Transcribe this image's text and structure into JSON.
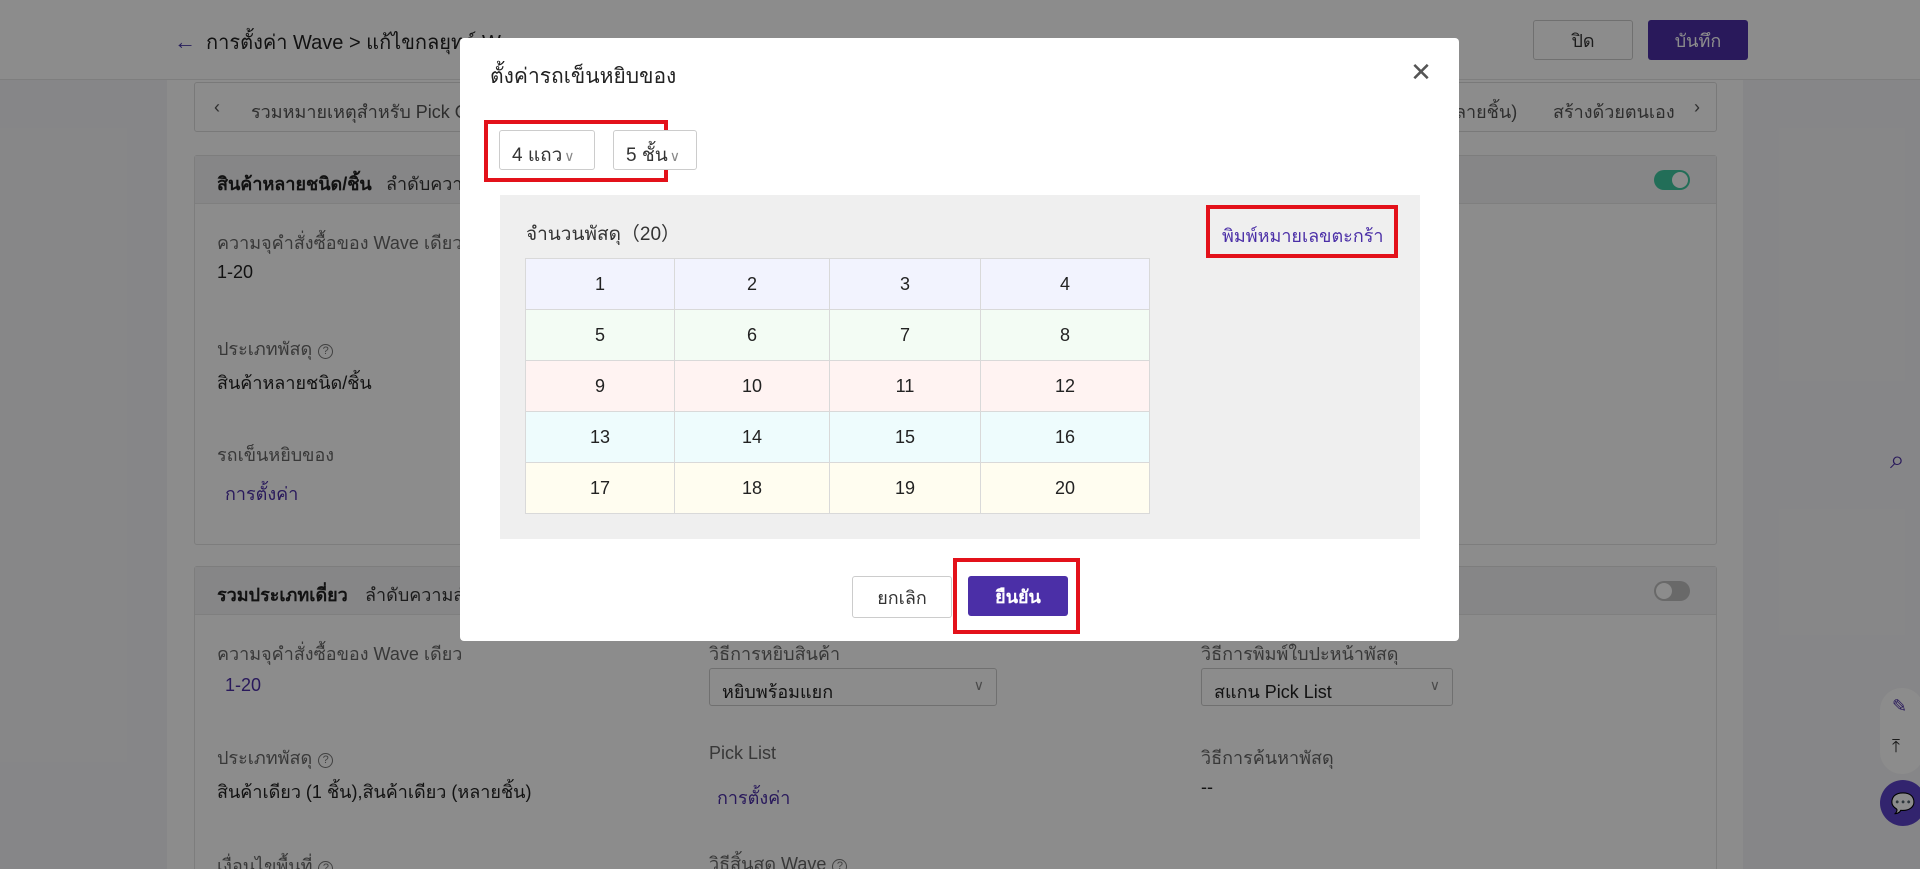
{
  "header": {
    "breadcrumb": "การตั้งค่า Wave > แก้ไขกลยุทธ์ Wave",
    "close_label": "ปิด",
    "save_label": "บันทึก"
  },
  "tabs": {
    "left_text": "รวมหมายเหตุสำหรับ Pick O",
    "right_text_1": "ลายชิ้น)",
    "right_text_2": "สร้างด้วยตนเอง"
  },
  "card1": {
    "title": "สินค้าหลายชนิด/ชิ้น",
    "subtitle": "ลำดับความ",
    "toggle_on": true,
    "capacity_label": "ความจุคำสั่งซื้อของ Wave เดียว",
    "capacity_value": "1-20",
    "parcel_type_label": "ประเภทพัสดุ",
    "parcel_type_value": "สินค้าหลายชนิด/ชิ้น",
    "cart_label": "รถเข็นหยิบของ",
    "cart_link": "การตั้งค่า"
  },
  "card2": {
    "title": "รวมประเภทเดี่ยว",
    "subtitle": "ลำดับความสำ",
    "toggle_on": false,
    "capacity_label": "ความจุคำสั่งซื้อของ Wave เดียว",
    "capacity_value": "1-20",
    "pick_method_label": "วิธีการหยิบสินค้า",
    "pick_method_value": "หยิบพร้อมแยก",
    "print_method_label": "วิธีการพิมพ์ใบปะหน้าพัสดุ",
    "print_method_value": "สแกน Pick List",
    "parcel_type_label": "ประเภทพัสดุ",
    "parcel_type_value": "สินค้าเดียว (1 ชิ้น),สินค้าเดียว (หลายชิ้น)",
    "pick_list_label": "Pick List",
    "pick_list_link": "การตั้งค่า",
    "search_method_label": "วิธีการค้นหาพัสดุ",
    "search_method_value": "--",
    "area_label": "เงื่อนไขพื้นที่",
    "wave_end_label": "วิธีสิ้นสุด Wave"
  },
  "modal": {
    "title": "ตั้งค่ารถเข็นหยิบของ",
    "rows_select": "4 แถว",
    "layers_select": "5 ชั้น",
    "parcel_count_label": "จำนวนพัสดุ（20）",
    "print_basket_link": "พิมพ์หมายเลขตะกร้า",
    "grid": [
      [
        "1",
        "2",
        "3",
        "4"
      ],
      [
        "5",
        "6",
        "7",
        "8"
      ],
      [
        "9",
        "10",
        "11",
        "12"
      ],
      [
        "13",
        "14",
        "15",
        "16"
      ],
      [
        "17",
        "18",
        "19",
        "20"
      ]
    ],
    "row_colors": [
      "#f2f3fe",
      "#f3fcf4",
      "#fff3f2",
      "#eefcfd",
      "#fffdf0"
    ],
    "cancel_label": "ยกเลิก",
    "confirm_label": "ยืนยัน"
  },
  "colors": {
    "accent": "#4b2fa7",
    "highlight": "#e3111a",
    "toggle_on": "#3ec9a0",
    "toggle_off": "#bfbfbf"
  }
}
